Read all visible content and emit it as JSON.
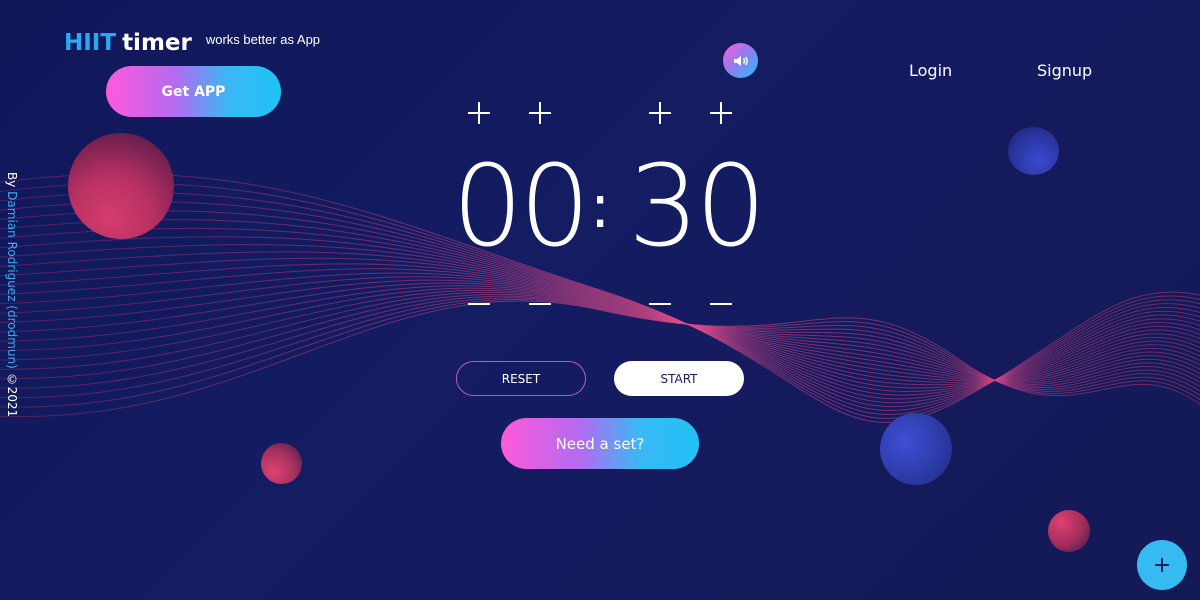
{
  "brand": {
    "name_part1": "HIIT",
    "name_part2": "timer",
    "tagline": "works better as App"
  },
  "header": {
    "get_app_label": "Get APP",
    "sound_icon": "speaker-icon"
  },
  "nav": {
    "login": "Login",
    "signup": "Signup"
  },
  "credit": {
    "prefix": "By",
    "author": "Damian Rodriguez (drodmun)",
    "suffix": "©2021"
  },
  "timer": {
    "minutes": "00",
    "separator": ":",
    "seconds": "30"
  },
  "controls": {
    "reset_label": "RESET",
    "start_label": "START",
    "need_set_label": "Need a set?"
  },
  "fab": {
    "icon": "plus-icon"
  },
  "colors": {
    "accent_blue": "#2aa9f0",
    "accent_pink": "#ff5ad9",
    "background": "#141c62"
  }
}
